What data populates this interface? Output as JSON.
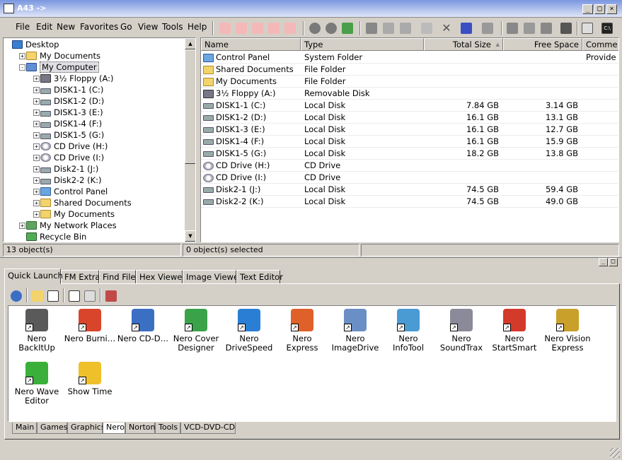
{
  "window": {
    "title": "A43 ->"
  },
  "menu": [
    "File",
    "Edit",
    "New",
    "Favorites",
    "Go",
    "View",
    "Tools",
    "Help"
  ],
  "tree": [
    {
      "label": "Desktop",
      "icon": "desktop-icon",
      "level": 0,
      "exp": ""
    },
    {
      "label": "My Documents",
      "icon": "folder-icon",
      "level": 1,
      "exp": "+"
    },
    {
      "label": "My Computer",
      "icon": "computer-icon",
      "level": 1,
      "exp": "-"
    },
    {
      "label": "3½ Floppy (A:)",
      "icon": "floppy-icon",
      "level": 2,
      "exp": "+"
    },
    {
      "label": "DISK1-1 (C:)",
      "icon": "drive-icon",
      "level": 2,
      "exp": "+"
    },
    {
      "label": "DISK1-2 (D:)",
      "icon": "drive-icon",
      "level": 2,
      "exp": "+"
    },
    {
      "label": "DISK1-3 (E:)",
      "icon": "drive-icon",
      "level": 2,
      "exp": "+"
    },
    {
      "label": "DISK1-4 (F:)",
      "icon": "drive-icon",
      "level": 2,
      "exp": "+"
    },
    {
      "label": "DISK1-5 (G:)",
      "icon": "drive-icon",
      "level": 2,
      "exp": "+"
    },
    {
      "label": "CD Drive (H:)",
      "icon": "cd-icon",
      "level": 2,
      "exp": "+"
    },
    {
      "label": "CD Drive (I:)",
      "icon": "cd-icon",
      "level": 2,
      "exp": "+"
    },
    {
      "label": "Disk2-1 (J:)",
      "icon": "drive-icon",
      "level": 2,
      "exp": "+"
    },
    {
      "label": "Disk2-2 (K:)",
      "icon": "drive-icon",
      "level": 2,
      "exp": "+"
    },
    {
      "label": "Control Panel",
      "icon": "control-panel-icon",
      "level": 2,
      "exp": "+"
    },
    {
      "label": "Shared Documents",
      "icon": "folder-icon",
      "level": 2,
      "exp": "+"
    },
    {
      "label": "My Documents",
      "icon": "folder-icon",
      "level": 2,
      "exp": "+"
    },
    {
      "label": "My Network Places",
      "icon": "network-icon",
      "level": 1,
      "exp": "+"
    },
    {
      "label": "Recycle Bin",
      "icon": "recycle-bin-icon",
      "level": 1,
      "exp": ""
    }
  ],
  "columns": {
    "name": "Name",
    "type": "Type",
    "total": "Total Size",
    "free": "Free Space",
    "comments": "Comme"
  },
  "rows": [
    {
      "name": "Control Panel",
      "type": "System Folder",
      "total": "",
      "free": "",
      "comments": "Provide",
      "icon": "control-panel-icon"
    },
    {
      "name": "Shared Documents",
      "type": "File Folder",
      "total": "",
      "free": "",
      "comments": "",
      "icon": "folder-icon"
    },
    {
      "name": "My Documents",
      "type": "File Folder",
      "total": "",
      "free": "",
      "comments": "",
      "icon": "folder-icon"
    },
    {
      "name": "3½ Floppy (A:)",
      "type": "Removable Disk",
      "total": "",
      "free": "",
      "comments": "",
      "icon": "floppy-icon"
    },
    {
      "name": "DISK1-1 (C:)",
      "type": "Local Disk",
      "total": "7.84 GB",
      "free": "3.14 GB",
      "comments": "",
      "icon": "drive-icon"
    },
    {
      "name": "DISK1-2 (D:)",
      "type": "Local Disk",
      "total": "16.1 GB",
      "free": "13.1 GB",
      "comments": "",
      "icon": "drive-icon"
    },
    {
      "name": "DISK1-3 (E:)",
      "type": "Local Disk",
      "total": "16.1 GB",
      "free": "12.7 GB",
      "comments": "",
      "icon": "drive-icon"
    },
    {
      "name": "DISK1-4 (F:)",
      "type": "Local Disk",
      "total": "16.1 GB",
      "free": "15.9 GB",
      "comments": "",
      "icon": "drive-icon"
    },
    {
      "name": "DISK1-5 (G:)",
      "type": "Local Disk",
      "total": "18.2 GB",
      "free": "13.8 GB",
      "comments": "",
      "icon": "drive-icon"
    },
    {
      "name": "CD Drive (H:)",
      "type": "CD Drive",
      "total": "",
      "free": "",
      "comments": "",
      "icon": "cd-icon"
    },
    {
      "name": "CD Drive (I:)",
      "type": "CD Drive",
      "total": "",
      "free": "",
      "comments": "",
      "icon": "cd-icon"
    },
    {
      "name": "Disk2-1 (J:)",
      "type": "Local Disk",
      "total": "74.5 GB",
      "free": "59.4 GB",
      "comments": "",
      "icon": "drive-icon"
    },
    {
      "name": "Disk2-2 (K:)",
      "type": "Local Disk",
      "total": "74.5 GB",
      "free": "49.0 GB",
      "comments": "",
      "icon": "drive-icon"
    }
  ],
  "status": {
    "objects": "13 object(s)",
    "selected": "0 object(s) selected"
  },
  "tabs": [
    "Quick Launch",
    "FM Extra",
    "Find File",
    "Hex Viewer",
    "Image Viewer",
    "Text Editor"
  ],
  "launch_items": [
    {
      "label": "Nero BackItUp",
      "color": "#5a5a5a",
      "icon": "nero-backitup-icon"
    },
    {
      "label": "Nero Burni…",
      "color": "#d9452b",
      "icon": "nero-burning-icon"
    },
    {
      "label": "Nero CD-D…",
      "color": "#3a6fc4",
      "icon": "nero-cd-icon"
    },
    {
      "label": "Nero Cover Designer",
      "color": "#3aa34a",
      "icon": "nero-cover-icon"
    },
    {
      "label": "Nero DriveSpeed",
      "color": "#2a7fd4",
      "icon": "nero-drivespeed-icon"
    },
    {
      "label": "Nero Express",
      "color": "#e0602a",
      "icon": "nero-express-icon"
    },
    {
      "label": "Nero ImageDrive",
      "color": "#6a8fc4",
      "icon": "nero-imagedrive-icon"
    },
    {
      "label": "Nero InfoTool",
      "color": "#4a9ad4",
      "icon": "nero-infotool-icon"
    },
    {
      "label": "Nero SoundTrax",
      "color": "#8a8a9a",
      "icon": "nero-soundtrax-icon"
    },
    {
      "label": "Nero StartSmart",
      "color": "#d43a2a",
      "icon": "nero-startsmart-icon"
    },
    {
      "label": "Nero Vision Express",
      "color": "#c8a02a",
      "icon": "nero-vision-icon"
    },
    {
      "label": "Nero Wave Editor",
      "color": "#3ab03a",
      "icon": "nero-wave-icon"
    },
    {
      "label": "Show Time",
      "color": "#f0c02a",
      "icon": "show-time-icon"
    }
  ],
  "bottom_tabs": [
    "Main",
    "Games",
    "Graphics",
    "Nero",
    "Norton",
    "Tools",
    "VCD-DVD-CD"
  ],
  "active_bottom_tab": "Nero"
}
